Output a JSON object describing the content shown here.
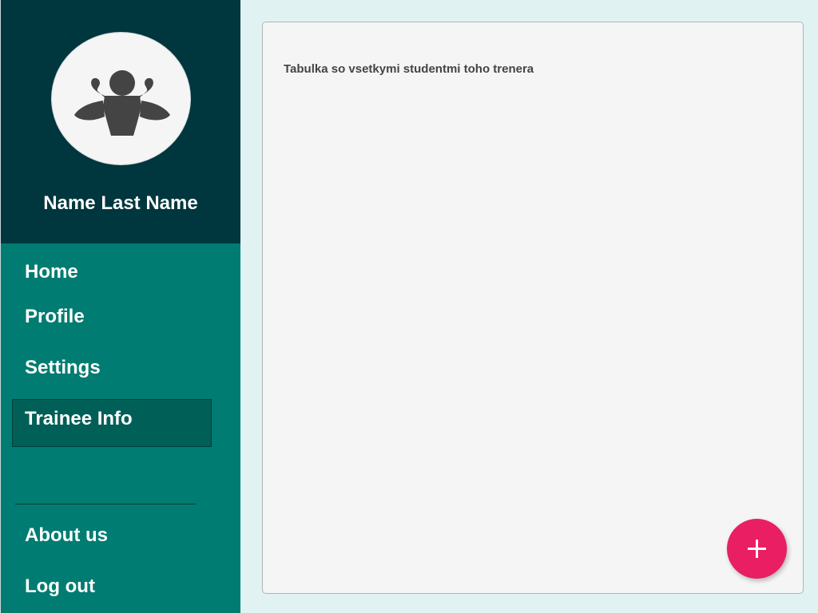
{
  "sidebar": {
    "user_name": "Name Last Name",
    "avatar_icon": "bodybuilder-icon",
    "nav": {
      "home": "Home",
      "profile": "Profile",
      "settings": "Settings",
      "trainee_info": "Trainee Info",
      "about_us": "About us",
      "log_out": "Log out"
    },
    "active_item": "Trainee Info"
  },
  "main": {
    "table_placeholder": "Tabulka so vsetkymi studentmi toho trenera"
  },
  "fab": {
    "icon": "plus-icon"
  },
  "colors": {
    "sidebar_header": "#00363d",
    "sidebar": "#007c72",
    "active_item": "#005f57",
    "background": "#e0f2f1",
    "fab": "#e91e63"
  }
}
